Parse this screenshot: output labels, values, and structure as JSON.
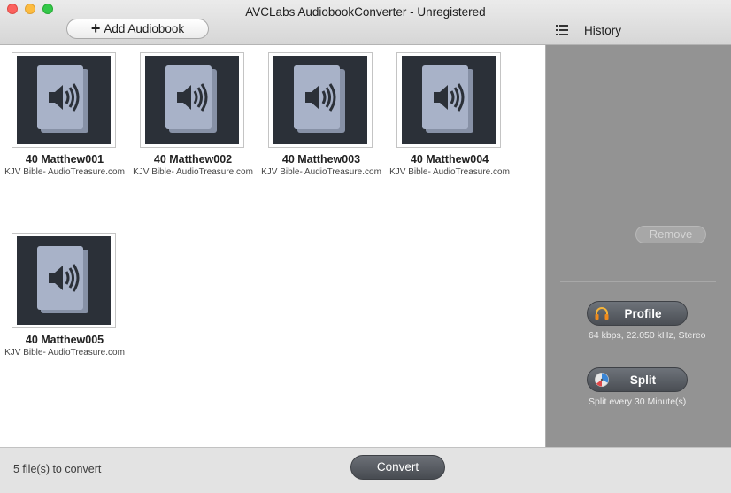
{
  "window": {
    "title": "AVCLabs AudiobookConverter - Unregistered"
  },
  "toolbar": {
    "add_label": "Add Audiobook",
    "history_label": "History"
  },
  "books": [
    {
      "title": "40 Matthew001",
      "author": "KJV Bible- AudioTreasure.com"
    },
    {
      "title": "40 Matthew002",
      "author": "KJV Bible- AudioTreasure.com"
    },
    {
      "title": "40 Matthew003",
      "author": "KJV Bible- AudioTreasure.com"
    },
    {
      "title": "40 Matthew004",
      "author": "KJV Bible- AudioTreasure.com"
    },
    {
      "title": "40 Matthew005",
      "author": "KJV Bible- AudioTreasure.com"
    }
  ],
  "side": {
    "remove_label": "Remove",
    "profile_label": "Profile",
    "profile_info": "64  kbps, 22.050 kHz, Stereo",
    "split_label": "Split",
    "split_info": "Split every 30 Minute(s)"
  },
  "footer": {
    "status": "5 file(s) to convert",
    "convert_label": "Convert"
  },
  "icons": {
    "audiobook": "audiobook-speaker-icon",
    "headphones": "headphones-icon",
    "split": "split-clock-icon",
    "history": "list-icon"
  },
  "colors": {
    "thumb_bg": "#2b3038",
    "book_icon": "#a8b2c8",
    "side_panel": "#939393"
  }
}
